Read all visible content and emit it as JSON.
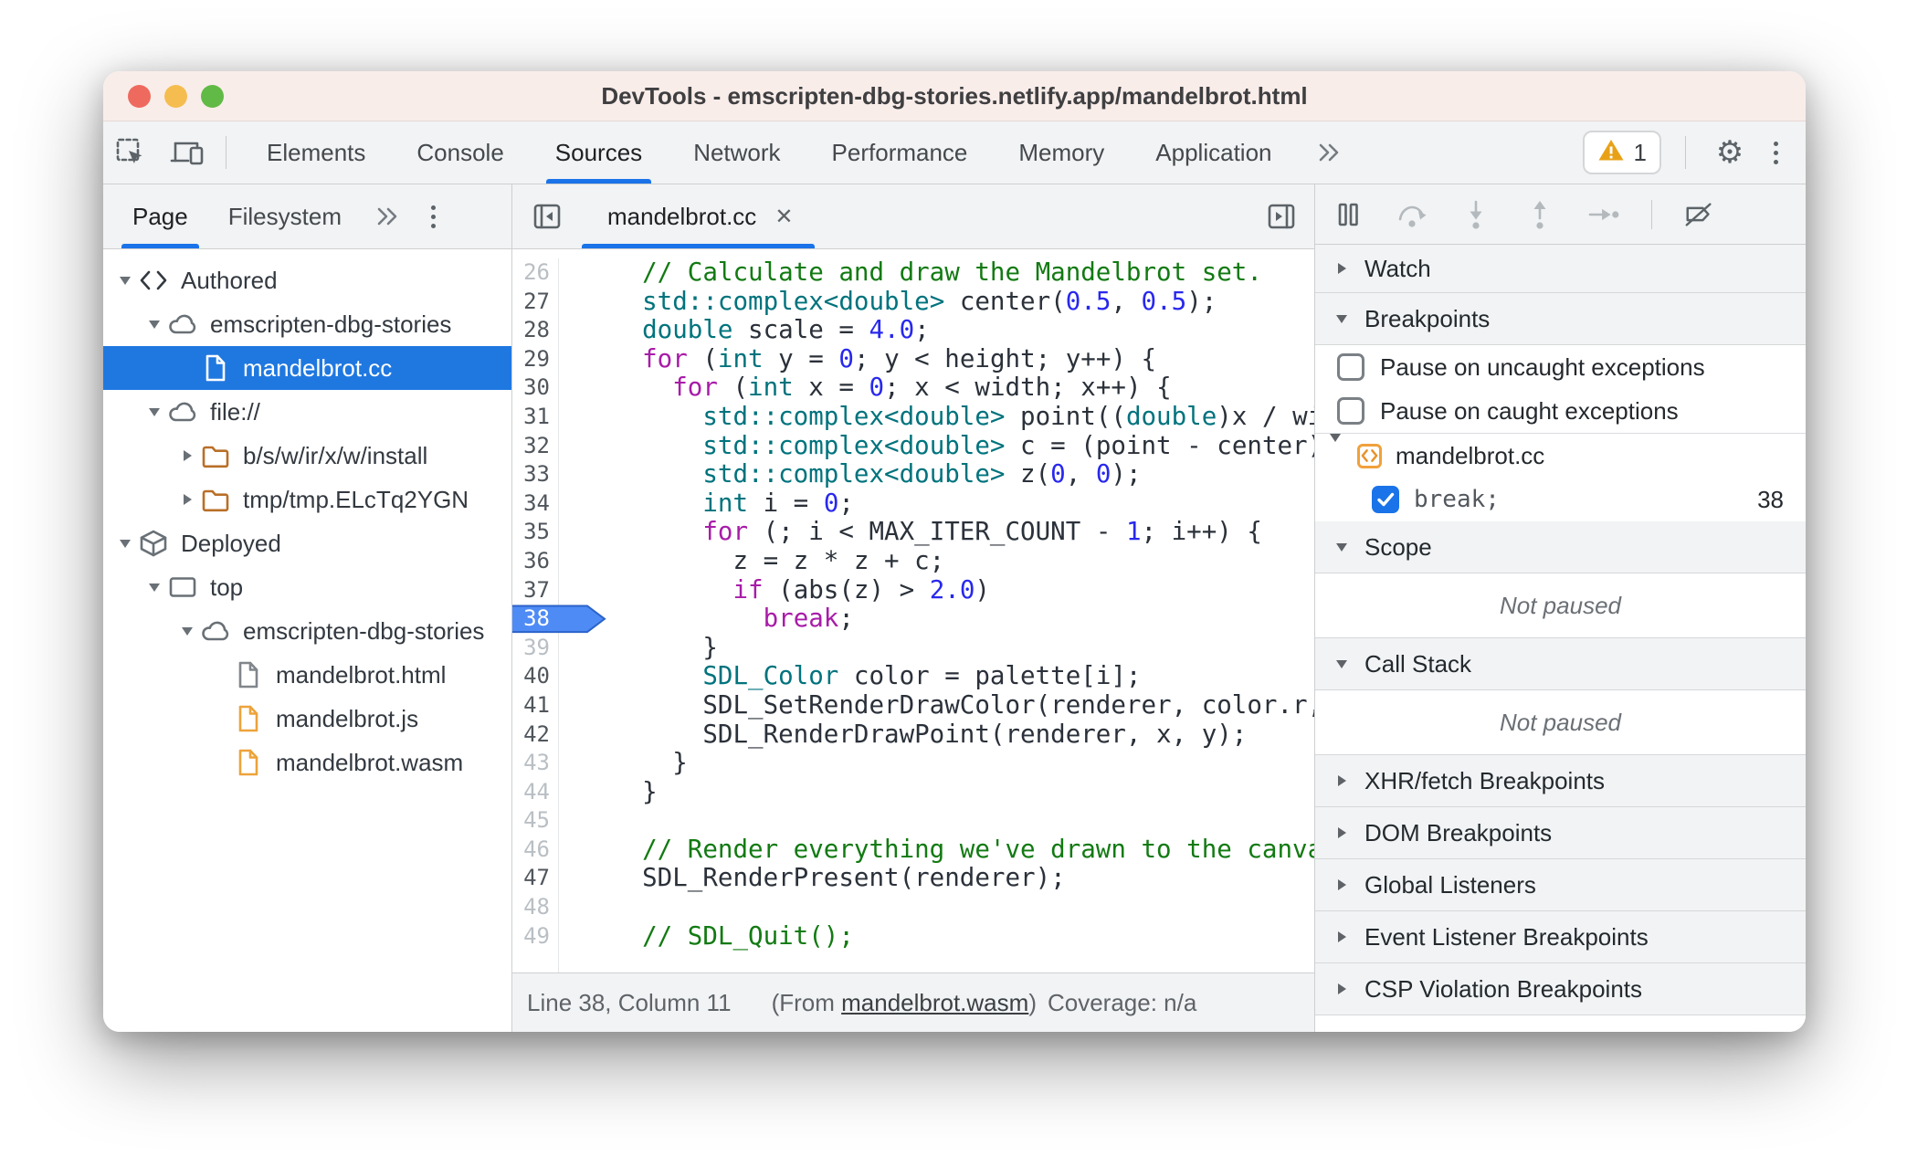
{
  "colors": {
    "accent_blue": "#1a73e8",
    "selection_blue": "#1f78e0",
    "breakpoint_badge_blue": "#4e8bf5",
    "warning_orange": "#e8a117",
    "folder_orange": "#b96f28",
    "file_orange": "#eda33b",
    "titlebar_pink": "#f9edea",
    "toolbar_gray": "#f1f3f4"
  },
  "window": {
    "title": "DevTools - emscripten-dbg-stories.netlify.app/mandelbrot.html"
  },
  "toolbar": {
    "tabs": [
      {
        "label": "Elements",
        "selected": false
      },
      {
        "label": "Console",
        "selected": false
      },
      {
        "label": "Sources",
        "selected": true
      },
      {
        "label": "Network",
        "selected": false
      },
      {
        "label": "Performance",
        "selected": false
      },
      {
        "label": "Memory",
        "selected": false
      },
      {
        "label": "Application",
        "selected": false
      }
    ],
    "warning_count": "1"
  },
  "navigator": {
    "tabs": [
      {
        "label": "Page",
        "selected": true
      },
      {
        "label": "Filesystem",
        "selected": false
      }
    ],
    "tree": [
      {
        "level": 0,
        "arrow": "down",
        "icon": "code-icon",
        "label": "Authored",
        "selected": false
      },
      {
        "level": 1,
        "arrow": "down",
        "icon": "cloud-icon",
        "label": "emscripten-dbg-stories",
        "selected": false
      },
      {
        "level": 2,
        "arrow": "none",
        "icon": "file-icon-selected",
        "label": "mandelbrot.cc",
        "selected": true
      },
      {
        "level": 1,
        "arrow": "down",
        "icon": "cloud-icon",
        "label": "file://",
        "selected": false
      },
      {
        "level": 2,
        "arrow": "right",
        "icon": "folder-icon",
        "label": "b/s/w/ir/x/w/install",
        "selected": false
      },
      {
        "level": 2,
        "arrow": "right",
        "icon": "folder-icon",
        "label": "tmp/tmp.ELcTq2YGN",
        "selected": false
      },
      {
        "level": 0,
        "arrow": "down",
        "icon": "deployed-cube-icon",
        "label": "Deployed",
        "selected": false
      },
      {
        "level": 1,
        "arrow": "down",
        "icon": "frame-icon",
        "label": "top",
        "selected": false
      },
      {
        "level": 2,
        "arrow": "down",
        "icon": "cloud-icon",
        "label": "emscripten-dbg-stories",
        "selected": false
      },
      {
        "level": 3,
        "arrow": "none",
        "icon": "file-icon-gray",
        "label": "mandelbrot.html",
        "selected": false
      },
      {
        "level": 3,
        "arrow": "none",
        "icon": "file-icon-orange",
        "label": "mandelbrot.js",
        "selected": false
      },
      {
        "level": 3,
        "arrow": "none",
        "icon": "file-icon-orange",
        "label": "mandelbrot.wasm",
        "selected": false
      }
    ]
  },
  "editor": {
    "tab_label": "mandelbrot.cc",
    "breakpoint_line": 38,
    "dim_lines": [
      26,
      39,
      43,
      44,
      45,
      46,
      48,
      49
    ],
    "lines": [
      {
        "n": 26,
        "tokens": [
          [
            "  // Calculate and draw the Mandelbrot set.",
            "c"
          ]
        ]
      },
      {
        "n": 27,
        "tokens": [
          [
            "  ",
            "p"
          ],
          [
            "std::complex<double>",
            "t"
          ],
          [
            " center(",
            "p"
          ],
          [
            "0.5",
            "n"
          ],
          [
            ", ",
            "p"
          ],
          [
            "0.5",
            "n"
          ],
          [
            ");",
            "p"
          ]
        ]
      },
      {
        "n": 28,
        "tokens": [
          [
            "  ",
            "p"
          ],
          [
            "double",
            "t"
          ],
          [
            " scale = ",
            "p"
          ],
          [
            "4.0",
            "n"
          ],
          [
            ";",
            "p"
          ]
        ]
      },
      {
        "n": 29,
        "tokens": [
          [
            "  ",
            "p"
          ],
          [
            "for",
            "k"
          ],
          [
            " (",
            "p"
          ],
          [
            "int",
            "t"
          ],
          [
            " y = ",
            "p"
          ],
          [
            "0",
            "n"
          ],
          [
            "; y < height; y++) {",
            "p"
          ]
        ]
      },
      {
        "n": 30,
        "tokens": [
          [
            "    ",
            "p"
          ],
          [
            "for",
            "k"
          ],
          [
            " (",
            "p"
          ],
          [
            "int",
            "t"
          ],
          [
            " x = ",
            "p"
          ],
          [
            "0",
            "n"
          ],
          [
            "; x < width; x++) {",
            "p"
          ]
        ]
      },
      {
        "n": 31,
        "tokens": [
          [
            "      ",
            "p"
          ],
          [
            "std::complex<double>",
            "t"
          ],
          [
            " point((",
            "p"
          ],
          [
            "double",
            "t"
          ],
          [
            ")x / width * scale -",
            "p"
          ]
        ]
      },
      {
        "n": 32,
        "tokens": [
          [
            "      ",
            "p"
          ],
          [
            "std::complex<double>",
            "t"
          ],
          [
            " c = (point - center) * scale;",
            "p"
          ]
        ]
      },
      {
        "n": 33,
        "tokens": [
          [
            "      ",
            "p"
          ],
          [
            "std::complex<double>",
            "t"
          ],
          [
            " z(",
            "p"
          ],
          [
            "0",
            "n"
          ],
          [
            ", ",
            "p"
          ],
          [
            "0",
            "n"
          ],
          [
            ");",
            "p"
          ]
        ]
      },
      {
        "n": 34,
        "tokens": [
          [
            "      ",
            "p"
          ],
          [
            "int",
            "t"
          ],
          [
            " i = ",
            "p"
          ],
          [
            "0",
            "n"
          ],
          [
            ";",
            "p"
          ]
        ]
      },
      {
        "n": 35,
        "tokens": [
          [
            "      ",
            "p"
          ],
          [
            "for",
            "k"
          ],
          [
            " (; i < MAX_ITER_COUNT - ",
            "p"
          ],
          [
            "1",
            "n"
          ],
          [
            "; i++) {",
            "p"
          ]
        ]
      },
      {
        "n": 36,
        "tokens": [
          [
            "        z = z * z + c;",
            "p"
          ]
        ]
      },
      {
        "n": 37,
        "tokens": [
          [
            "        ",
            "p"
          ],
          [
            "if",
            "k"
          ],
          [
            " (abs(z) > ",
            "p"
          ],
          [
            "2.0",
            "n"
          ],
          [
            ")",
            "p"
          ]
        ]
      },
      {
        "n": 38,
        "tokens": [
          [
            "          ",
            "p"
          ],
          [
            "break",
            "k"
          ],
          [
            ";",
            "p"
          ]
        ]
      },
      {
        "n": 39,
        "tokens": [
          [
            "      }",
            "p"
          ]
        ]
      },
      {
        "n": 40,
        "tokens": [
          [
            "      ",
            "p"
          ],
          [
            "SDL_Color",
            "t"
          ],
          [
            " color = palette[i];",
            "p"
          ]
        ]
      },
      {
        "n": 41,
        "tokens": [
          [
            "      SDL_SetRenderDrawColor(renderer, color.r, color.g,",
            "p"
          ]
        ]
      },
      {
        "n": 42,
        "tokens": [
          [
            "      SDL_RenderDrawPoint(renderer, x, y);",
            "p"
          ]
        ]
      },
      {
        "n": 43,
        "tokens": [
          [
            "    }",
            "p"
          ]
        ]
      },
      {
        "n": 44,
        "tokens": [
          [
            "  }",
            "p"
          ]
        ]
      },
      {
        "n": 45,
        "tokens": []
      },
      {
        "n": 46,
        "tokens": [
          [
            "  // Render everything we've drawn to the canvas.",
            "c"
          ]
        ]
      },
      {
        "n": 47,
        "tokens": [
          [
            "  SDL_RenderPresent(renderer);",
            "p"
          ]
        ]
      },
      {
        "n": 48,
        "tokens": []
      },
      {
        "n": 49,
        "tokens": [
          [
            "  // SDL_Quit();",
            "c"
          ]
        ]
      }
    ]
  },
  "status_bar": {
    "position": "Line 38, Column 11",
    "from_prefix": "(From ",
    "from_link": "mandelbrot.wasm",
    "from_suffix": ")",
    "coverage": "Coverage: n/a"
  },
  "debugger": {
    "controls": [
      {
        "name": "pause",
        "enabled": true,
        "divider_before": false
      },
      {
        "name": "step-over",
        "enabled": false,
        "divider_before": false
      },
      {
        "name": "step-into",
        "enabled": false,
        "divider_before": false
      },
      {
        "name": "step-out",
        "enabled": false,
        "divider_before": false
      },
      {
        "name": "step",
        "enabled": false,
        "divider_before": false
      },
      {
        "name": "deactivate-breakpoints",
        "enabled": true,
        "divider_before": true
      }
    ],
    "sections": [
      {
        "label": "Watch",
        "state": "collapsed",
        "kind": "plain"
      },
      {
        "label": "Breakpoints",
        "state": "expanded",
        "kind": "breakpoints"
      },
      {
        "label": "Scope",
        "state": "expanded",
        "kind": "message",
        "message": "Not paused"
      },
      {
        "label": "Call Stack",
        "state": "expanded",
        "kind": "message",
        "message": "Not paused"
      },
      {
        "label": "XHR/fetch Breakpoints",
        "state": "collapsed",
        "kind": "plain"
      },
      {
        "label": "DOM Breakpoints",
        "state": "collapsed",
        "kind": "plain"
      },
      {
        "label": "Global Listeners",
        "state": "collapsed",
        "kind": "plain"
      },
      {
        "label": "Event Listener Breakpoints",
        "state": "collapsed",
        "kind": "plain"
      },
      {
        "label": "CSP Violation Breakpoints",
        "state": "collapsed",
        "kind": "plain"
      }
    ],
    "breakpoints": {
      "options": [
        {
          "label": "Pause on uncaught exceptions",
          "checked": false
        },
        {
          "label": "Pause on caught exceptions",
          "checked": false
        }
      ],
      "file_group": {
        "label": "mandelbrot.cc"
      },
      "items": [
        {
          "label": "break;",
          "line": "38",
          "checked": true
        }
      ]
    }
  }
}
